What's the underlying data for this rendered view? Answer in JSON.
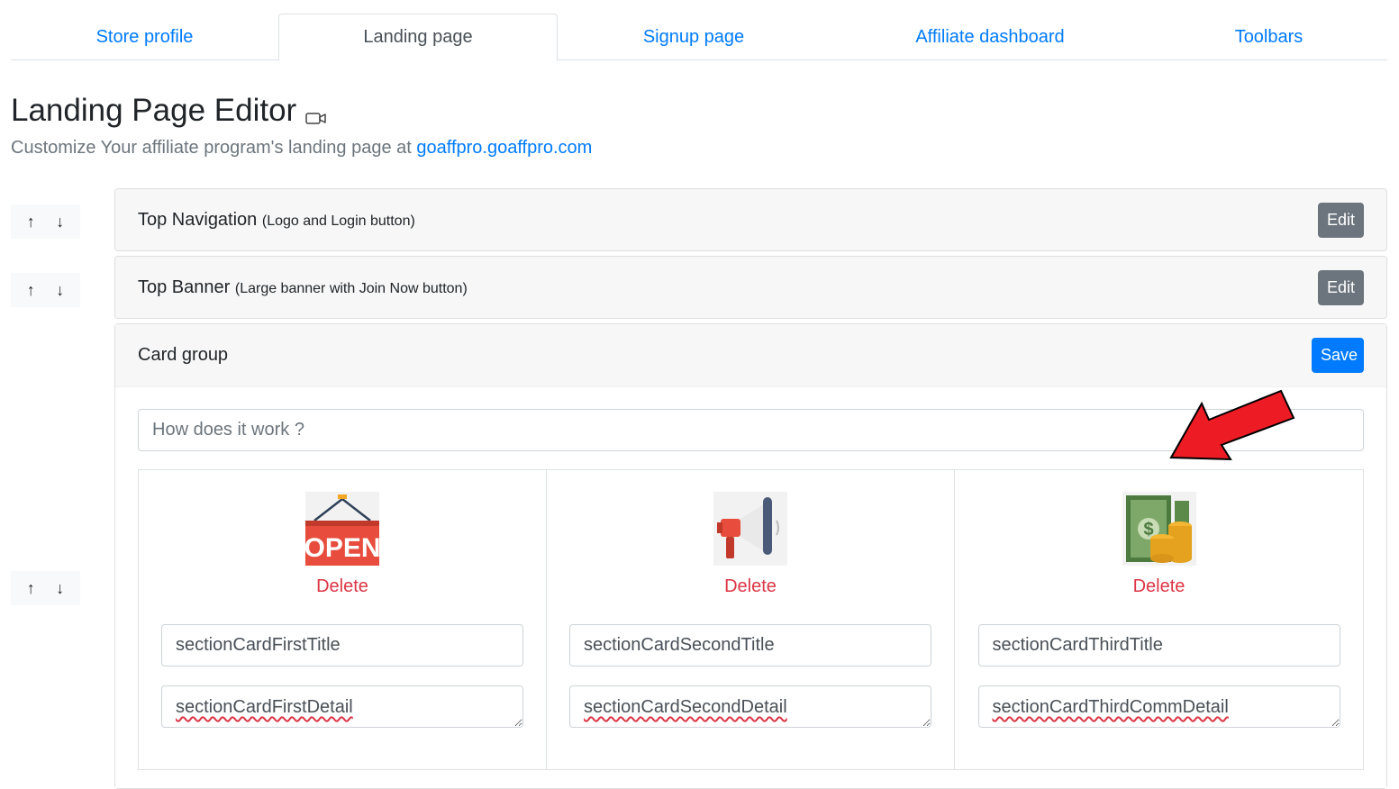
{
  "tabs": [
    {
      "label": "Store profile",
      "active": false
    },
    {
      "label": "Landing page",
      "active": true
    },
    {
      "label": "Signup page",
      "active": false
    },
    {
      "label": "Affiliate dashboard",
      "active": false
    },
    {
      "label": "Toolbars",
      "active": false
    }
  ],
  "header": {
    "title": "Landing Page Editor",
    "title_icon": "video-camera-icon",
    "subtitle_prefix": "Customize Your affiliate program's landing page at ",
    "subtitle_link": "goaffpro.goaffpro.com"
  },
  "order_controls": {
    "up_icon": "↑",
    "down_icon": "↓"
  },
  "sections": [
    {
      "title": "Top Navigation",
      "subtitle": "(Logo and Login button)",
      "button": "Edit"
    },
    {
      "title": "Top Banner",
      "subtitle": "(Large banner with Join Now button)",
      "button": "Edit"
    },
    {
      "title": "Card group",
      "subtitle": "",
      "button": "Save"
    }
  ],
  "card_group": {
    "heading_placeholder": "How does it work ?",
    "delete_label": "Delete",
    "cards": [
      {
        "image_icon": "open-sign-icon",
        "title": "sectionCardFirstTitle",
        "detail": "sectionCardFirstDetail"
      },
      {
        "image_icon": "megaphone-icon",
        "title": "sectionCardSecondTitle",
        "detail": "sectionCardSecondDetail"
      },
      {
        "image_icon": "money-coins-icon",
        "title": "sectionCardThirdTitle",
        "detail": "sectionCardThirdCommDetail"
      }
    ]
  },
  "colors": {
    "link": "#007bff",
    "edit_button": "#6c757d",
    "save_button": "#007bff",
    "delete": "#dc3545",
    "annotation_arrow": "#ed1c24"
  }
}
